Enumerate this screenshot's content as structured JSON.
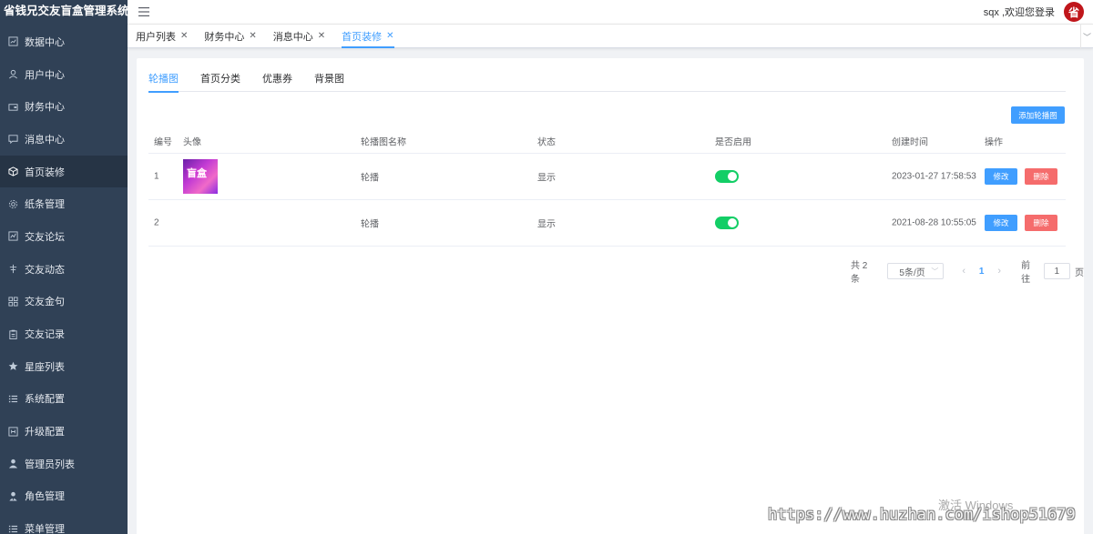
{
  "app": {
    "title": "省钱兄交友盲盒管理系统"
  },
  "sidebar": {
    "items": [
      {
        "label": "数据中心",
        "icon": "dashboard-icon"
      },
      {
        "label": "用户中心",
        "icon": "user-icon"
      },
      {
        "label": "财务中心",
        "icon": "wallet-icon"
      },
      {
        "label": "消息中心",
        "icon": "message-icon"
      },
      {
        "label": "首页装修",
        "icon": "box-icon",
        "active": true
      },
      {
        "label": "纸条管理",
        "icon": "gear-icon"
      },
      {
        "label": "交友论坛",
        "icon": "chart-icon"
      },
      {
        "label": "交友动态",
        "icon": "tree-icon"
      },
      {
        "label": "交友金句",
        "icon": "grid-icon"
      },
      {
        "label": "交友记录",
        "icon": "clipboard-icon"
      },
      {
        "label": "星座列表",
        "icon": "star-icon"
      },
      {
        "label": "系统配置",
        "icon": "list-icon"
      },
      {
        "label": "升级配置",
        "icon": "upgrade-icon"
      },
      {
        "label": "管理员列表",
        "icon": "person-icon"
      },
      {
        "label": "角色管理",
        "icon": "role-icon"
      },
      {
        "label": "菜单管理",
        "icon": "list-icon"
      }
    ]
  },
  "header": {
    "welcome": "sqx ,欢迎您登录",
    "avatar_text": "省"
  },
  "tags": [
    {
      "label": "用户列表"
    },
    {
      "label": "财务中心"
    },
    {
      "label": "消息中心"
    },
    {
      "label": "首页装修",
      "active": true
    }
  ],
  "tabs": [
    {
      "label": "轮播图",
      "active": true
    },
    {
      "label": "首页分类"
    },
    {
      "label": "优惠券"
    },
    {
      "label": "背景图"
    }
  ],
  "add_button": "添加轮播图",
  "table": {
    "columns": [
      "编号",
      "头像",
      "轮播图名称",
      "状态",
      "是否启用",
      "创建时间",
      "操作"
    ],
    "rows": [
      {
        "id": "1",
        "has_image": true,
        "name": "轮播",
        "status": "显示",
        "enabled": true,
        "created": "2023-01-27 17:58:53"
      },
      {
        "id": "2",
        "has_image": false,
        "name": "轮播",
        "status": "显示",
        "enabled": true,
        "created": "2021-08-28 10:55:05"
      }
    ],
    "edit_label": "修改",
    "delete_label": "删除"
  },
  "pagination": {
    "total": "共 2 条",
    "page_size": "5条/页",
    "current_page": "1",
    "goto_label": "前往",
    "goto_value": "1",
    "page_unit": "页"
  },
  "watermarks": {
    "activate": "激活 Windows",
    "url": "https://www.huzhan.com/ishop51679"
  },
  "thumb_text": "盲盒"
}
